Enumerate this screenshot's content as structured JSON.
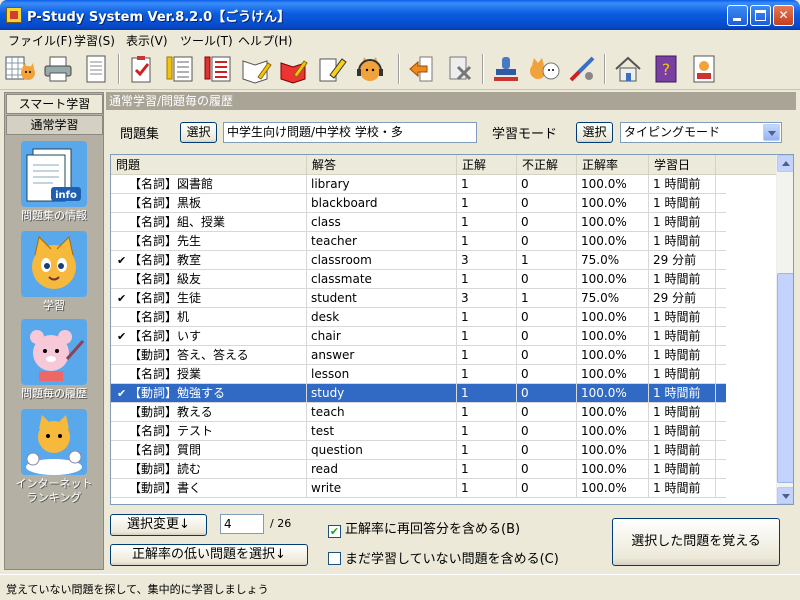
{
  "window": {
    "title": "P-Study System Ver.8.2.0【ごうけん】"
  },
  "menu": [
    "ファイル(F)",
    "学習(S)",
    "表示(V)",
    "ツール(T)",
    "ヘルプ(H)"
  ],
  "sidebar": {
    "tabs": [
      "スマート学習",
      "通常学習"
    ],
    "items": [
      {
        "label": "問題集の情報",
        "icon": "info-icon"
      },
      {
        "label": "学習",
        "icon": "cat-study-icon"
      },
      {
        "label": "問題毎の履歴",
        "icon": "bear-teacher-icon"
      },
      {
        "label": "インターネット\nランキング",
        "icon": "ranking-icon"
      }
    ]
  },
  "content": {
    "breadcrumb": "通常学習/問題毎の履歴",
    "problemset_label": "問題集",
    "select_label": "選択",
    "problemset_value": "中学生向け問題/中学校 学校・多",
    "mode_label": "学習モード",
    "mode_value": "タイピングモード"
  },
  "table": {
    "columns": [
      "問題",
      "解答",
      "正解",
      "不正解",
      "正解率",
      "学習日"
    ],
    "rows": [
      {
        "checked": false,
        "q": "【名詞】図書館",
        "a": "library",
        "ok": "1",
        "ng": "0",
        "rate": "100.0%",
        "date": "1 時間前"
      },
      {
        "checked": false,
        "q": "【名詞】黒板",
        "a": "blackboard",
        "ok": "1",
        "ng": "0",
        "rate": "100.0%",
        "date": "1 時間前"
      },
      {
        "checked": false,
        "q": "【名詞】組、授業",
        "a": "class",
        "ok": "1",
        "ng": "0",
        "rate": "100.0%",
        "date": "1 時間前"
      },
      {
        "checked": false,
        "q": "【名詞】先生",
        "a": "teacher",
        "ok": "1",
        "ng": "0",
        "rate": "100.0%",
        "date": "1 時間前"
      },
      {
        "checked": true,
        "q": "【名詞】教室",
        "a": "classroom",
        "ok": "3",
        "ng": "1",
        "rate": "75.0%",
        "date": "29 分前"
      },
      {
        "checked": false,
        "q": "【名詞】級友",
        "a": "classmate",
        "ok": "1",
        "ng": "0",
        "rate": "100.0%",
        "date": "1 時間前"
      },
      {
        "checked": true,
        "q": "【名詞】生徒",
        "a": "student",
        "ok": "3",
        "ng": "1",
        "rate": "75.0%",
        "date": "29 分前"
      },
      {
        "checked": false,
        "q": "【名詞】机",
        "a": "desk",
        "ok": "1",
        "ng": "0",
        "rate": "100.0%",
        "date": "1 時間前"
      },
      {
        "checked": true,
        "q": "【名詞】いす",
        "a": "chair",
        "ok": "1",
        "ng": "0",
        "rate": "100.0%",
        "date": "1 時間前"
      },
      {
        "checked": false,
        "q": "【動詞】答え、答える",
        "a": "answer",
        "ok": "1",
        "ng": "0",
        "rate": "100.0%",
        "date": "1 時間前"
      },
      {
        "checked": false,
        "q": "【名詞】授業",
        "a": "lesson",
        "ok": "1",
        "ng": "0",
        "rate": "100.0%",
        "date": "1 時間前"
      },
      {
        "checked": true,
        "q": "【動詞】勉強する",
        "a": "study",
        "ok": "1",
        "ng": "0",
        "rate": "100.0%",
        "date": "1 時間前"
      },
      {
        "checked": false,
        "q": "【動詞】教える",
        "a": "teach",
        "ok": "1",
        "ng": "0",
        "rate": "100.0%",
        "date": "1 時間前"
      },
      {
        "checked": false,
        "q": "【名詞】テスト",
        "a": "test",
        "ok": "1",
        "ng": "0",
        "rate": "100.0%",
        "date": "1 時間前"
      },
      {
        "checked": false,
        "q": "【名詞】質問",
        "a": "question",
        "ok": "1",
        "ng": "0",
        "rate": "100.0%",
        "date": "1 時間前"
      },
      {
        "checked": false,
        "q": "【動詞】読む",
        "a": "read",
        "ok": "1",
        "ng": "0",
        "rate": "100.0%",
        "date": "1 時間前"
      },
      {
        "checked": false,
        "q": "【動詞】書く",
        "a": "write",
        "ok": "1",
        "ng": "0",
        "rate": "100.0%",
        "date": "1 時間前"
      }
    ],
    "selected_index": 11
  },
  "footer": {
    "change_selection": "選択変更↓",
    "count_value": "4",
    "count_total": "/ 26",
    "select_low_rate": "正解率の低い問題を選択↓",
    "include_reanswer": "正解率に再回答分を含める(B)",
    "include_reanswer_checked": true,
    "include_unstudied": "まだ学習していない問題を含める(C)",
    "include_unstudied_checked": false,
    "memorize": "選択した問題を覚える"
  },
  "status": "覚えていない問題を探して、集中的に学習しましょう"
}
